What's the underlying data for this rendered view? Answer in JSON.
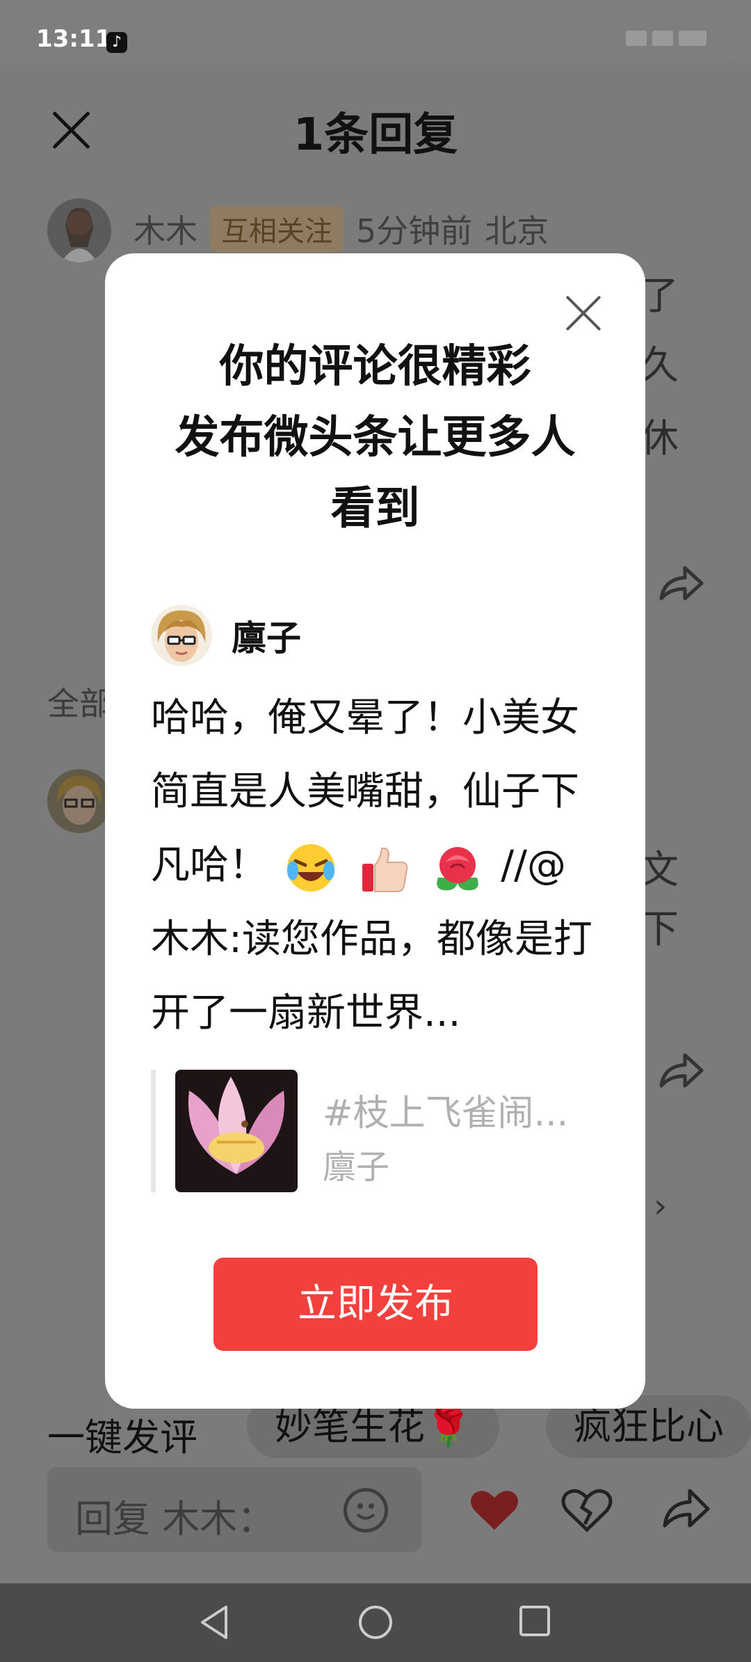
{
  "status_bar": {
    "time": "13:11"
  },
  "sheet": {
    "title": "1条回复",
    "top_comment": {
      "username": "木木",
      "tag": "互相关注",
      "time": "5分钟前",
      "location": "北京",
      "partial_text_1": "了",
      "partial_text_2": "久",
      "partial_text_3": "休"
    },
    "section_label": "全部",
    "reply_partial_text_1": "文",
    "reply_partial_text_2": "下"
  },
  "quick_comments": {
    "label": "一键发评",
    "chips": [
      "妙笔生花🌹",
      "疯狂比心"
    ]
  },
  "reply_input": {
    "placeholder": "回复 木木："
  },
  "modal": {
    "title_line1": "你的评论很精彩",
    "title_line2": "发布微头条让更多人",
    "title_line3": "看到",
    "author_name": "廪子",
    "comment_part1": "哈哈，俺又晕了！小美女简直是人美嘴甜，仙子下凡哈！",
    "comment_part2": "//@木木:读您作品，都像是打开了一扇新世界...",
    "quote_title": "#枝上飞雀闹...",
    "quote_author": "廪子",
    "publish_button": "立即发布"
  }
}
